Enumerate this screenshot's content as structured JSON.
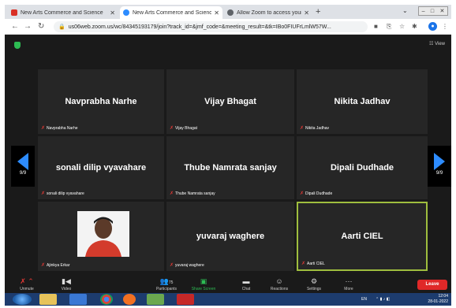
{
  "browser": {
    "tabs": [
      {
        "label": "New Arts Commerce and Science",
        "close": "✕",
        "favicon_color": "#d93025",
        "active": false
      },
      {
        "label": "New Arts Commerce and Science",
        "close": "✕",
        "favicon_color": "#2d8cff",
        "active": true
      },
      {
        "label": "Allow Zoom to access your came",
        "close": "✕",
        "favicon_color": "#5f6368",
        "active": false
      }
    ],
    "new_tab": "+",
    "url": "us06web.zoom.us/wc/84345193179/join?track_id=&jmf_code=&meeting_result=&tk=IBo0FIUFrLmlW57W..."
  },
  "zoom": {
    "view_label": "View",
    "page_indicator": "9/9",
    "participants": [
      {
        "name": "Navprabha Narhe",
        "label": "Navprabha Narhe"
      },
      {
        "name": "Vijay Bhagat",
        "label": "Vijay Bhagat"
      },
      {
        "name": "Nikita Jadhav",
        "label": "Nikita Jadhav"
      },
      {
        "name": "sonali dilip vyavahare",
        "label": "sonali dilip vyavahare"
      },
      {
        "name": "Thube Namrata sanjay",
        "label": "Thube Namrata sanjay"
      },
      {
        "name": "Dipali Dudhade",
        "label": "Dipali Dudhade"
      },
      {
        "name": "",
        "label": "Ajinkya Erkar"
      },
      {
        "name": "yuvaraj waghere",
        "label": "yuvaraj waghere"
      },
      {
        "name": "Aarti CIEL",
        "label": "Aarti CIEL"
      }
    ],
    "highlight_color": "#9fbe3e",
    "toolbar": {
      "unmute": "Unmute",
      "video": "Video",
      "participants": "Participants",
      "participants_count": "75",
      "share": "Share Screen",
      "chat": "Chat",
      "reactions": "Reactions",
      "settings": "Settings",
      "more": "More",
      "leave": "Leave"
    }
  },
  "taskbar": {
    "lang": "EN",
    "time": "12:04",
    "date": "28-01-2022"
  }
}
